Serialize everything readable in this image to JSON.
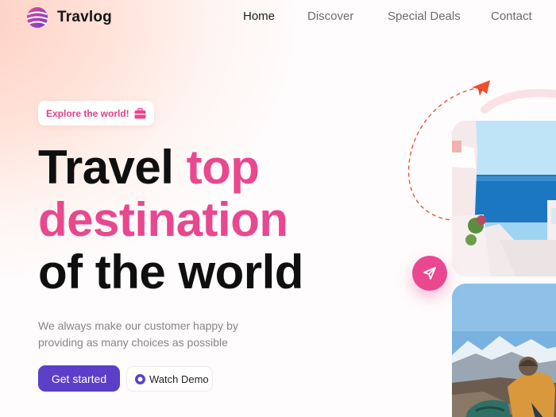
{
  "brand": {
    "name": "Travlog",
    "accent": "#e9478f",
    "primary": "#5b3fc9"
  },
  "nav": {
    "items": [
      {
        "label": "Home",
        "active": true
      },
      {
        "label": "Discover",
        "active": false
      },
      {
        "label": "Special Deals",
        "active": false
      },
      {
        "label": "Contact",
        "active": false
      }
    ]
  },
  "hero": {
    "badge": {
      "label": "Explore the world!",
      "icon": "briefcase-icon"
    },
    "headline": {
      "part1": "Travel ",
      "highlight": "top destination",
      "highlight_line1": "top",
      "highlight_line2": "destination",
      "part3": "of the world"
    },
    "subtitle": "We always make our customer happy by providing as many choices as possible",
    "primary_button": "Get started",
    "secondary_button": "Watch Demo"
  },
  "visuals": {
    "photos": [
      "santorini-photo",
      "mountain-hiker-photo"
    ],
    "icons": [
      "plane-icon",
      "send-icon",
      "play-icon"
    ]
  }
}
